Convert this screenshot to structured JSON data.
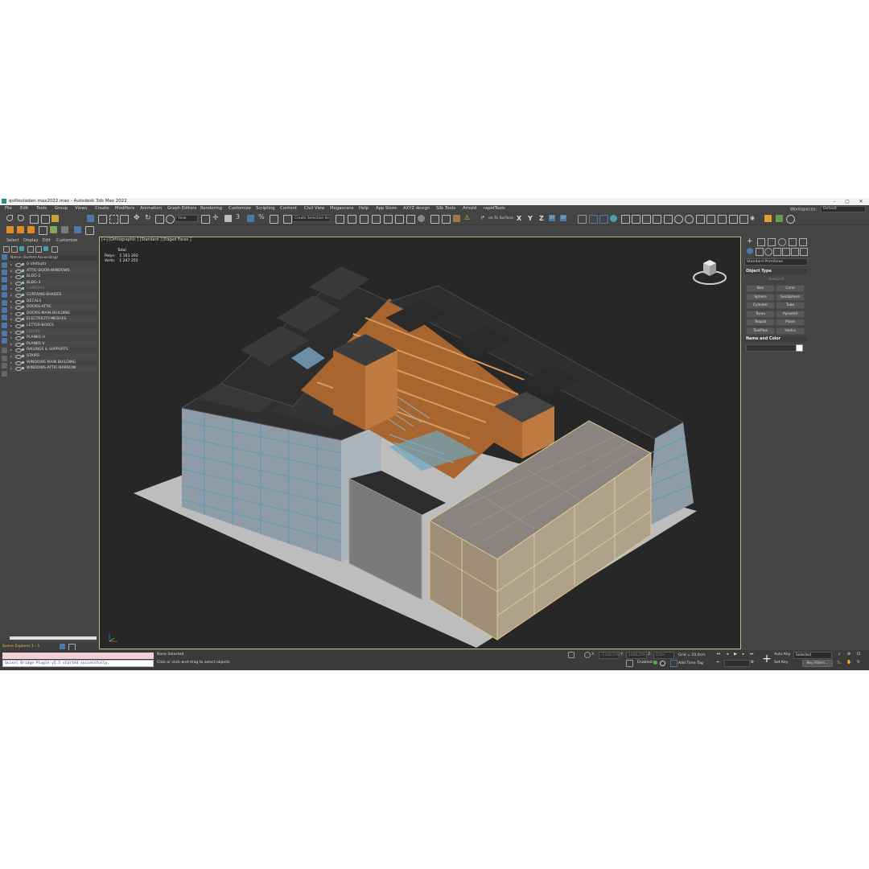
{
  "window": {
    "title": "qvillestaden-max2022.max - Autodesk 3ds Max 2022",
    "minimize": "–",
    "maximize": "▢",
    "close": "✕"
  },
  "menu": [
    "File",
    "Edit",
    "Tools",
    "Group",
    "Views",
    "Create",
    "Modifiers",
    "Animation",
    "Graph Editors",
    "Rendering",
    "Customize",
    "Scripting",
    "Content",
    "Civil View",
    "Megascans",
    "Help",
    "App Store",
    "AXYZ design",
    "Silk Tools",
    "Arnold",
    "rapidTools"
  ],
  "workspace": {
    "label": "Workspaces:",
    "value": "Default"
  },
  "toolbar": {
    "filter_dropdown": "View",
    "view_dropdown": "View",
    "selection_set": "Create Selection Se",
    "snap_label": "3",
    "percent_label": "%",
    "unlink_label": "on To Surface",
    "axis_x": "X",
    "axis_y": "Y",
    "axis_z": "Z",
    "axis_xy": "XY",
    "axis_xy2": "XY"
  },
  "scene_explorer": {
    "menu": [
      "Select",
      "Display",
      "Edit",
      "Customize"
    ],
    "header": "Name (Sorted Ascending)",
    "layers": [
      {
        "name": "0 (default)",
        "dim": false
      },
      {
        "name": "ATTIC-DOOR-WINDOWS",
        "dim": false
      },
      {
        "name": "BLDG-2",
        "dim": false
      },
      {
        "name": "BLDG-3",
        "dim": false
      },
      {
        "name": "CAMERAS",
        "dim": true
      },
      {
        "name": "CURTAINS-SHADES",
        "dim": false
      },
      {
        "name": "DECALS",
        "dim": false
      },
      {
        "name": "DOORS-ATTIC",
        "dim": false
      },
      {
        "name": "DOORS-MAIN-BUILDING",
        "dim": false
      },
      {
        "name": "ELECTRICITY-MESHES",
        "dim": false
      },
      {
        "name": "LETTER-BOXES",
        "dim": false
      },
      {
        "name": "LIGHTS",
        "dim": true
      },
      {
        "name": "PLANKS H",
        "dim": false
      },
      {
        "name": "PLANKS V",
        "dim": false
      },
      {
        "name": "RAILINGS & SUPPORTS",
        "dim": false
      },
      {
        "name": "STAIRS",
        "dim": false
      },
      {
        "name": "WINDOWS MAIN BUILDING",
        "dim": false
      },
      {
        "name": "WINDOWS-ATTIC-NARROW",
        "dim": false
      }
    ],
    "footer": "Scene Explorer 1 - 1"
  },
  "viewport": {
    "label": "[+] [Orthographic ] [Standard ] [Edged Faces ]",
    "stats_title": "Total",
    "polys_label": "Polys:",
    "polys_value": "1 161 292",
    "verts_label": "Verts:",
    "verts_value": "1 247 255"
  },
  "command_panel": {
    "category": "Standard Primitives",
    "object_type_title": "Object Type",
    "autogrid": "AutoGrid",
    "buttons": [
      "Box",
      "Cone",
      "Sphere",
      "GeoSphere",
      "Cylinder",
      "Tube",
      "Torus",
      "Pyramid",
      "Teapot",
      "Plane",
      "TextPlus",
      "Hedra"
    ],
    "name_color_title": "Name and Color"
  },
  "status": {
    "maxscript_output": "Quixel Bridge Plugin v5.5 started successfully.",
    "selection": "None Selected",
    "prompt": "Click or click-and-drag to select objects",
    "x_label": "X:",
    "x_value": "-1148,579",
    "y_label": "Y:",
    "y_value": "1048,209",
    "z_label": "Z:",
    "z_value": "0,0m",
    "grid": "Grid = 10,0cm",
    "enabled": "Enabled:",
    "add_time_tag": "Add Time Tag",
    "auto_key": "Auto Key",
    "set_key": "Set Key",
    "selected": "Selected",
    "key_filters": "Key Filters..."
  },
  "colors": {
    "ui_bg": "#444444",
    "viewport_bg": "#272727",
    "accent_blue": "#4e78a8",
    "timber": "#b46a32",
    "roof": "#2f2f2f"
  }
}
